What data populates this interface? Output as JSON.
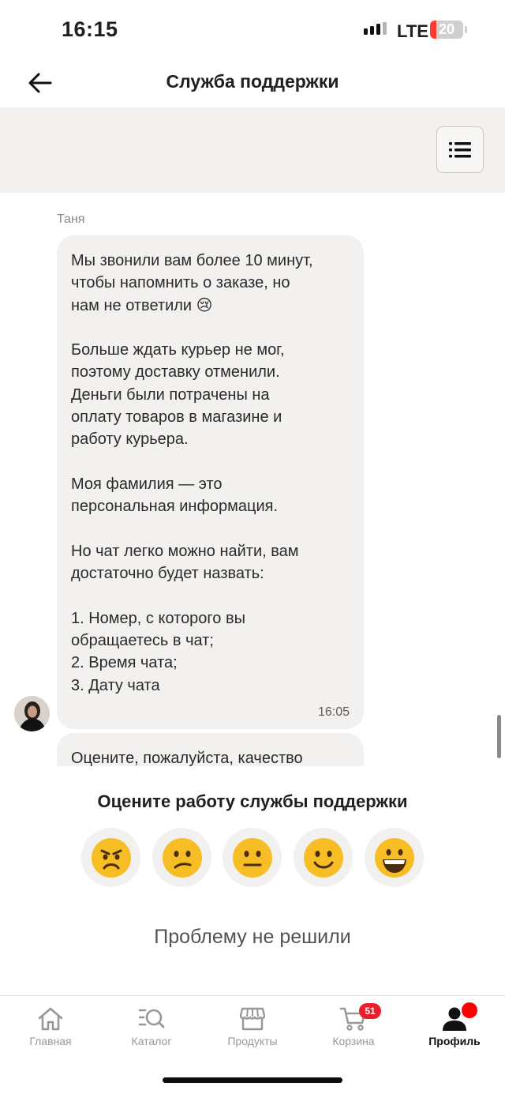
{
  "status_bar": {
    "time": "16:15",
    "network": "LTE",
    "battery": "20",
    "battery_level": 0.2
  },
  "header": {
    "title": "Служба поддержки"
  },
  "chat": {
    "sender": "Таня",
    "message_lines": [
      "Мы звонили вам более 10 минут,",
      "чтобы напомнить о заказе, но",
      "нам не ответили 😢",
      "",
      "Больше ждать курьер не мог,",
      "поэтому доставку отменили.",
      "Деньги были потрачены на",
      "оплату товаров в магазине и",
      "работу курьера.",
      "",
      "Моя фамилия — это",
      "персональная информация.",
      "",
      "Но чат легко можно найти, вам",
      "достаточно будет назвать:",
      "",
      "1. Номер, с которого вы",
      "обращаетесь в чат;",
      "2. Время чата;",
      "3. Дату чата"
    ],
    "message_time": "16:05",
    "next_message_preview": "Оцените, пожалуйста, качество"
  },
  "rating": {
    "title": "Оцените работу службы поддержки",
    "emojis": [
      "😠",
      "😕",
      "😐",
      "🙂",
      "😀"
    ],
    "unsolved_label": "Проблему не решили"
  },
  "tabbar": {
    "tabs": [
      {
        "label": "Главная",
        "icon": "home-icon"
      },
      {
        "label": "Каталог",
        "icon": "catalog-search-icon"
      },
      {
        "label": "Продукты",
        "icon": "store-icon"
      },
      {
        "label": "Корзина",
        "icon": "cart-icon"
      },
      {
        "label": "Профиль",
        "icon": "profile-icon"
      }
    ],
    "cart_badge": "51",
    "active_tab": "Профиль"
  }
}
